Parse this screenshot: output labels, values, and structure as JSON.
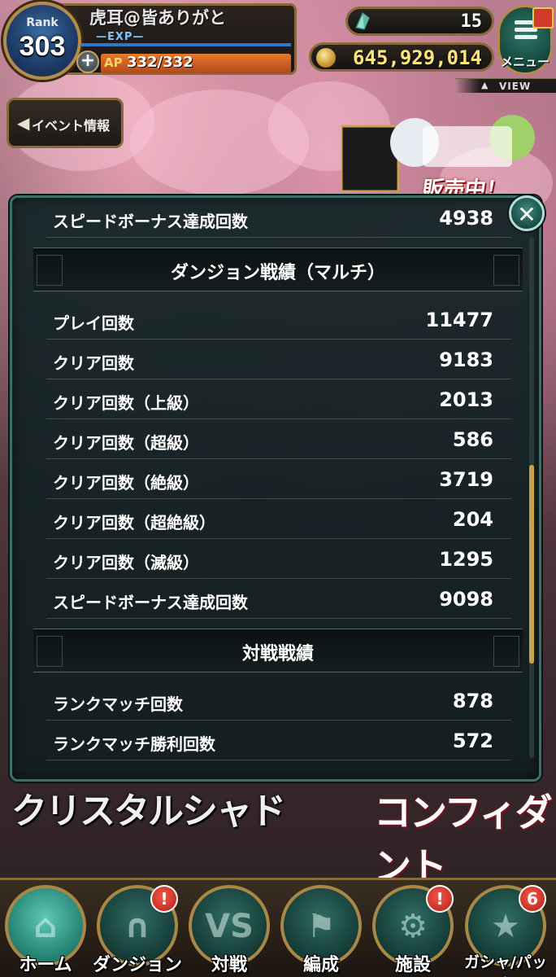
{
  "hud": {
    "rank_label": "Rank",
    "rank_value": "303",
    "player_name": "虎耳@皆ありがと",
    "exp_label": "—EXP—",
    "ap_label": "AP",
    "ap_value": "332/332",
    "crystal_count": "15",
    "coin_count": "645,929,014",
    "menu_label": "メニュー",
    "view_label": "VIEW",
    "event_button_label": "イベント情報"
  },
  "banner": {
    "top_text": "販売中！",
    "lower_left_text": "クリスタルシャド",
    "lower_right_text": "コンフィダント"
  },
  "stats": {
    "first_row": {
      "label": "スピードボーナス達成回数",
      "value": "4938"
    },
    "multi_section_title": "ダンジョン戦績（マルチ）",
    "multi_rows": [
      {
        "label": "プレイ回数",
        "value": "11477"
      },
      {
        "label": "クリア回数",
        "value": "9183"
      },
      {
        "label": "クリア回数（上級）",
        "value": "2013"
      },
      {
        "label": "クリア回数（超級）",
        "value": "586"
      },
      {
        "label": "クリア回数（絶級）",
        "value": "3719"
      },
      {
        "label": "クリア回数（超絶級）",
        "value": "204"
      },
      {
        "label": "クリア回数（滅級）",
        "value": "1295"
      },
      {
        "label": "スピードボーナス達成回数",
        "value": "9098"
      }
    ],
    "battle_section_title": "対戦戦績",
    "battle_rows": [
      {
        "label": "ランクマッチ回数",
        "value": "878"
      },
      {
        "label": "ランクマッチ勝利回数",
        "value": "572"
      }
    ]
  },
  "nav": {
    "items": [
      {
        "label": "ホーム",
        "glyph": "⌂"
      },
      {
        "label": "ダンジョン",
        "glyph": "∩",
        "badge": "!"
      },
      {
        "label": "対戦",
        "glyph": "VS"
      },
      {
        "label": "編成",
        "glyph": "⚑"
      },
      {
        "label": "施設",
        "glyph": "⚙",
        "badge": "!"
      },
      {
        "label": "ガシャ/パック",
        "glyph": "★",
        "badge": "6"
      }
    ]
  },
  "colors": {
    "accent_gold": "#a98746",
    "dialog_border": "#3e6e6a",
    "badge_red": "#d5352a",
    "coin_text": "#ffe57a"
  }
}
